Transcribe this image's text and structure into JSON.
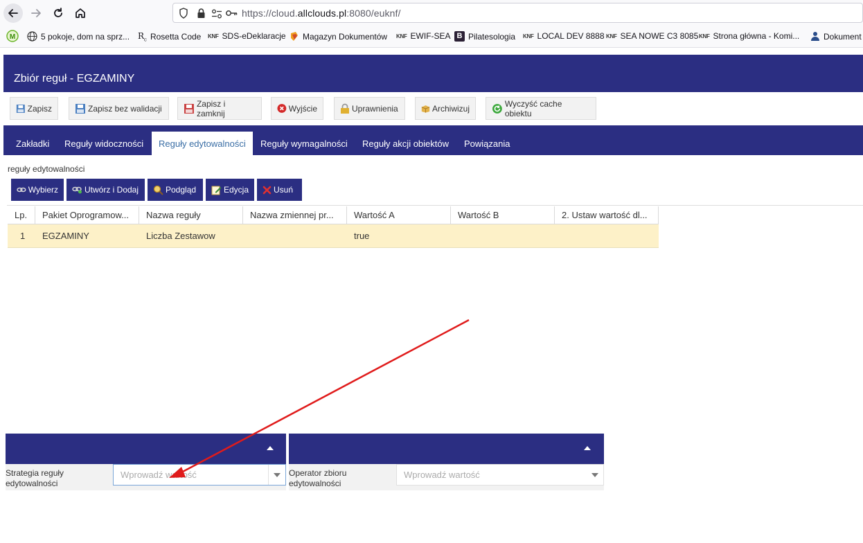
{
  "browser": {
    "url_prefix": "https://cloud.",
    "url_domain": "allclouds.pl",
    "url_suffix": ":8080/euknf/",
    "bookmarks": [
      {
        "label": "5 pokoje, dom na sprz..."
      },
      {
        "label": "Rosetta Code"
      },
      {
        "label": "SDS-eDeklaracje"
      },
      {
        "label": "Magazyn Dokumentów"
      },
      {
        "label": "EWIF-SEA"
      },
      {
        "label": "Pilatesologia"
      },
      {
        "label": "LOCAL DEV 8888"
      },
      {
        "label": "SEA NOWE C3 8085"
      },
      {
        "label": "Strona główna - Komi..."
      },
      {
        "label": "Dokument"
      }
    ],
    "knf_badge": "KNF",
    "bm_letter": "B",
    "rc_glyph": "R"
  },
  "window": {
    "title": "Zbiór reguł - EGZAMINY"
  },
  "toolbar": {
    "save": "Zapisz",
    "save_no_validation": "Zapisz bez walidacji",
    "save_close": "Zapisz i zamknij",
    "exit": "Wyjście",
    "permissions": "Uprawnienia",
    "archive": "Archiwizuj",
    "clear_cache": "Wyczyść cache obiektu"
  },
  "tabs": [
    {
      "label": "Zakładki"
    },
    {
      "label": "Reguły widoczności"
    },
    {
      "label": "Reguły edytowalności",
      "active": true
    },
    {
      "label": "Reguły wymagalności"
    },
    {
      "label": "Reguły akcji obiektów"
    },
    {
      "label": "Powiązania"
    }
  ],
  "section": {
    "label": "reguły edytowalności",
    "actions": {
      "select": "Wybierz",
      "create_add": "Utwórz i Dodaj",
      "preview": "Podgląd",
      "edit": "Edycja",
      "delete": "Usuń"
    }
  },
  "grid": {
    "headers": [
      "Lp.",
      "Pakiet Oprogramow...",
      "Nazwa reguły",
      "Nazwa zmiennej pr...",
      "Wartość A",
      "Wartość B",
      "2. Ustaw wartość dl..."
    ],
    "rows": [
      [
        "1",
        "EGZAMINY",
        "Liczba Zestawow",
        "",
        "true",
        "",
        ""
      ]
    ]
  },
  "form": {
    "strategy_label": "Strategia reguły edytowalności",
    "strategy_placeholder": "Wprowadź wartość",
    "operator_label": "Operator zbioru edytowalności",
    "operator_placeholder": "Wprowadź wartość"
  },
  "annotation": {
    "color": "#e01b1b"
  }
}
